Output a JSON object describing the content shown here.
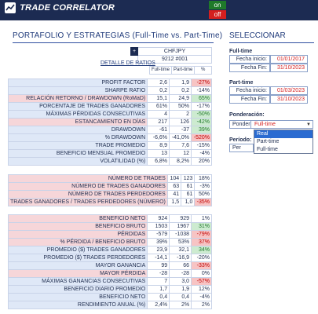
{
  "app": {
    "title": "TRADE CORRELATOR",
    "toggle_on": "on",
    "toggle_off": "off"
  },
  "main": {
    "title": "PORTAFOLIO Y ESTRATEGIAS (Full-Time vs. Part-Time)"
  },
  "side": {
    "title": "SELECCIONAR"
  },
  "header": {
    "symbol": "CHFJPY",
    "strategy": "9212 #001",
    "detail_label": "DETALLE DE RATIOS",
    "col_full": "Full-time",
    "col_part": "Part-time",
    "col_pct": "%"
  },
  "ratios": [
    {
      "label": "PROFIT FACTOR",
      "full": "2,6",
      "part": "1,9",
      "pct": "-27%",
      "tone": "red",
      "shade": "blue"
    },
    {
      "label": "SHARPE RATIO",
      "full": "0,2",
      "part": "0,2",
      "pct": "-14%",
      "tone": "white",
      "shade": "blue"
    },
    {
      "label": "RELACIÓN RETORNO / DRAWDOWN (RoMaD)",
      "full": "15,1",
      "part": "24,9",
      "pct": "65%",
      "tone": "green",
      "shade": "pink"
    },
    {
      "label": "PORCENTAJE DE TRADES GANADORES",
      "full": "61%",
      "part": "50%",
      "pct": "-17%",
      "tone": "white",
      "shade": "blue"
    },
    {
      "label": "MÁXIMAS PÉRDIDAS CONSECUTIVAS",
      "full": "4",
      "part": "2",
      "pct": "-50%",
      "tone": "green",
      "shade": "blue"
    },
    {
      "label": "ESTANCAMIENTO EN DÍAS",
      "full": "217",
      "part": "126",
      "pct": "-42%",
      "tone": "green",
      "shade": "pink"
    },
    {
      "label": "DRAWDOWN",
      "full": "-61",
      "part": "-37",
      "pct": "39%",
      "tone": "green",
      "shade": "blue"
    },
    {
      "label": "% DRAWDOWN",
      "full": "-6,6%",
      "part": "-41,0%",
      "pct": "-520%",
      "tone": "red",
      "shade": "blue"
    },
    {
      "label": "TRADE PROMEDIO",
      "full": "8,9",
      "part": "7,6",
      "pct": "-15%",
      "tone": "white",
      "shade": "blue"
    },
    {
      "label": "BENEFICIO MENSUAL PROMEDIO",
      "full": "13",
      "part": "12",
      "pct": "-4%",
      "tone": "white",
      "shade": "blue"
    },
    {
      "label": "VOLATILIDAD (%)",
      "full": "6,8%",
      "part": "8,2%",
      "pct": "20%",
      "tone": "white",
      "shade": "blue"
    }
  ],
  "trades": [
    {
      "label": "NÚMERO DE TRADES",
      "full": "104",
      "part": "123",
      "pct": "18%",
      "tone": "white",
      "shade": "pink"
    },
    {
      "label": "NÚMERO DE TRADES GANADORES",
      "full": "63",
      "part": "61",
      "pct": "-3%",
      "tone": "white",
      "shade": "pink"
    },
    {
      "label": "NÚMERO DE TRADES PERDEDORES",
      "full": "41",
      "part": "61",
      "pct": "50%",
      "tone": "white",
      "shade": "pink"
    },
    {
      "label": "TRADES GANADORES / TRADES PERDEDORES (NÚMERO)",
      "full": "1,5",
      "part": "1,0",
      "pct": "-35%",
      "tone": "red",
      "shade": "pink"
    }
  ],
  "profits": [
    {
      "label": "BENEFICIO NETO",
      "full": "924",
      "part": "929",
      "pct": "1%",
      "tone": "white",
      "shade": "pink"
    },
    {
      "label": "BENEFICIO BRUTO",
      "full": "1503",
      "part": "1967",
      "pct": "31%",
      "tone": "green",
      "shade": "pink"
    },
    {
      "label": "PÉRDIDAS",
      "full": "-579",
      "part": "-1038",
      "pct": "-79%",
      "tone": "red",
      "shade": "pink"
    },
    {
      "label": "% PÉRDIDA / BENEFICIO BRUTO",
      "full": "39%",
      "part": "53%",
      "pct": "37%",
      "tone": "red",
      "shade": "pink"
    },
    {
      "label": "PROMEDIO ($) TRADES GANADORES",
      "full": "23,9",
      "part": "32,1",
      "pct": "34%",
      "tone": "green",
      "shade": "blue"
    },
    {
      "label": "PROMEDIO ($) TRADES PERDEDORES",
      "full": "-14,1",
      "part": "-16,9",
      "pct": "-20%",
      "tone": "white",
      "shade": "blue"
    },
    {
      "label": "MAYOR GANANCIA",
      "full": "99",
      "part": "66",
      "pct": "-33%",
      "tone": "red",
      "shade": "blue"
    },
    {
      "label": "MAYOR PÉRDIDA",
      "full": "-28",
      "part": "-28",
      "pct": "0%",
      "tone": "white",
      "shade": "pink"
    },
    {
      "label": "MÁXIMAS GANANCIAS CONSECUTIVAS",
      "full": "7",
      "part": "3,0",
      "pct": "-57%",
      "tone": "red",
      "shade": "blue"
    },
    {
      "label": "BENEFICIO DIARIO PROMEDIO",
      "full": "1,7",
      "part": "1,9",
      "pct": "12%",
      "tone": "white",
      "shade": "blue"
    },
    {
      "label": "BENEFICIO NETO",
      "full": "0,4",
      "part": "0,4",
      "pct": "-4%",
      "tone": "white",
      "shade": "blue"
    },
    {
      "label": "RENDIMIENTO ANUAL (%)",
      "full": "2,4%",
      "part": "2%",
      "pct": "2%",
      "tone": "white",
      "shade": "blue"
    }
  ],
  "full": {
    "title": "Full-time",
    "start_label": "Fecha inicio:",
    "start": "01/01/2017",
    "end_label": "Fecha Fin:",
    "end": "31/10/2023"
  },
  "part": {
    "title": "Part-time",
    "start_label": "Fecha inicio:",
    "start": "01/03/2023",
    "end_label": "Fecha Fin:",
    "end": "31/10/2023"
  },
  "pond": {
    "title": "Ponderación:",
    "label": "Ponderación:",
    "value": "Full-time",
    "options": [
      "Real",
      "Part-time",
      "Full-time"
    ]
  },
  "periodo": {
    "title": "Período:",
    "label": "Per"
  }
}
